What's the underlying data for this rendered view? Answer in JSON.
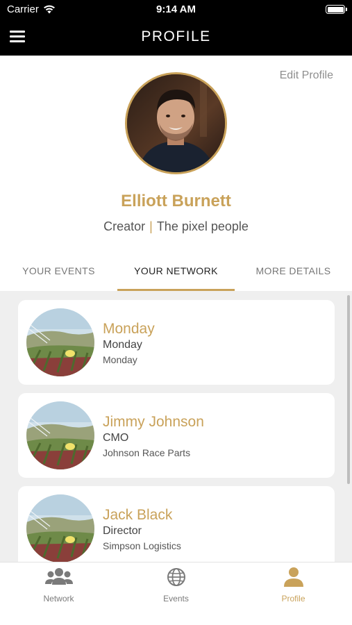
{
  "status_bar": {
    "carrier": "Carrier",
    "time": "9:14 AM"
  },
  "nav": {
    "title": "PROFILE",
    "menu_icon": "hamburger-menu-icon"
  },
  "profile": {
    "edit_label": "Edit Profile",
    "name": "Elliott Burnett",
    "role": "Creator",
    "separator": "|",
    "company": "The pixel people"
  },
  "tabs": [
    {
      "label": "YOUR EVENTS",
      "active": false
    },
    {
      "label": "YOUR NETWORK",
      "active": true
    },
    {
      "label": "MORE DETAILS",
      "active": false
    }
  ],
  "network": [
    {
      "name": "Monday",
      "role": "Monday",
      "company": "Monday"
    },
    {
      "name": "Jimmy Johnson",
      "role": "CMO",
      "company": "Johnson Race Parts"
    },
    {
      "name": "Jack Black",
      "role": "Director",
      "company": "Simpson Logistics"
    }
  ],
  "bottom_tabs": [
    {
      "label": "Network",
      "icon": "people-icon",
      "active": false
    },
    {
      "label": "Events",
      "icon": "globe-icon",
      "active": false
    },
    {
      "label": "Profile",
      "icon": "person-icon",
      "active": true
    }
  ],
  "colors": {
    "accent": "#c9a25a",
    "nav_background": "#000000",
    "list_background": "#efefef"
  }
}
